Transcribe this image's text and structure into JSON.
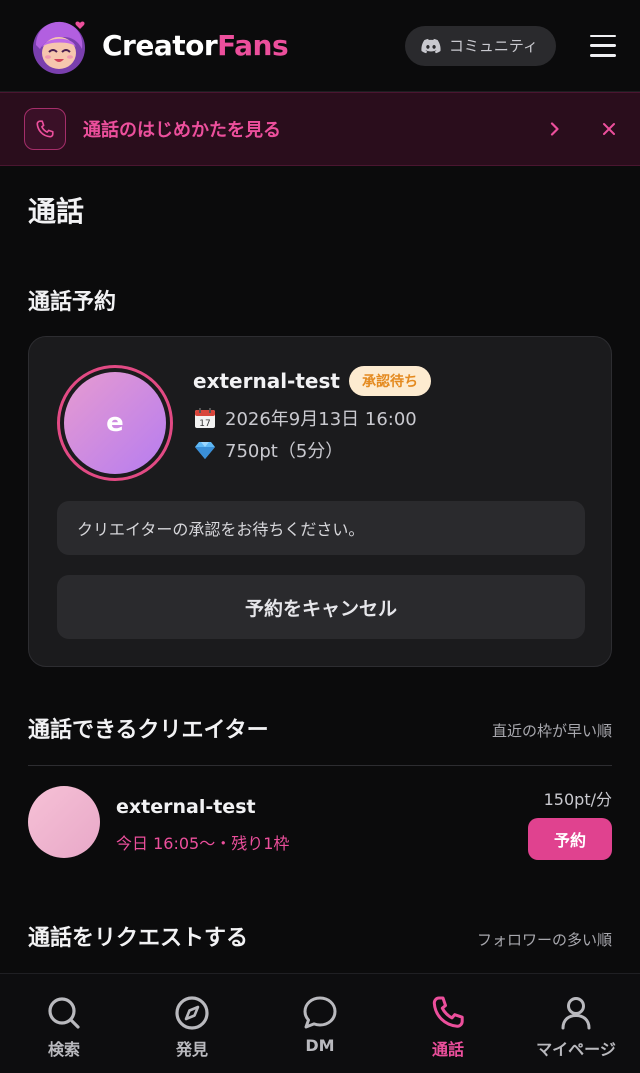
{
  "header": {
    "brand_part1": "Creator",
    "brand_part2": "Fans",
    "community_label": "コミュニティ"
  },
  "banner": {
    "text": "通話のはじめかたを見る"
  },
  "page": {
    "title": "通話"
  },
  "reservation": {
    "section_title": "通話予約",
    "avatar_letter": "e",
    "name": "external-test",
    "status_badge": "承認待ち",
    "datetime": "2026年9月13日 16:00",
    "price": "750pt（5分）",
    "note": "クリエイターの承認をお待ちください。",
    "cancel_label": "予約をキャンセル"
  },
  "available": {
    "section_title": "通話できるクリエイター",
    "sort_label": "直近の枠が早い順",
    "creators": [
      {
        "name": "external-test",
        "slot": "今日 16:05〜・残り1枠",
        "price": "150pt/分",
        "reserve_label": "予約"
      }
    ]
  },
  "request": {
    "section_title": "通話をリクエストする",
    "sort_label": "フォロワーの多い順"
  },
  "bottom_nav": [
    {
      "label": "検索",
      "icon": "search-icon"
    },
    {
      "label": "発見",
      "icon": "compass-icon"
    },
    {
      "label": "DM",
      "icon": "chat-bubble-icon"
    },
    {
      "label": "通話",
      "icon": "phone-icon",
      "active": true
    },
    {
      "label": "マイページ",
      "icon": "user-icon"
    }
  ],
  "colors": {
    "accent": "#ec4f9c",
    "background": "#0b0b0c",
    "badge_bg": "#fdebd0",
    "badge_text": "#e48a1f"
  }
}
